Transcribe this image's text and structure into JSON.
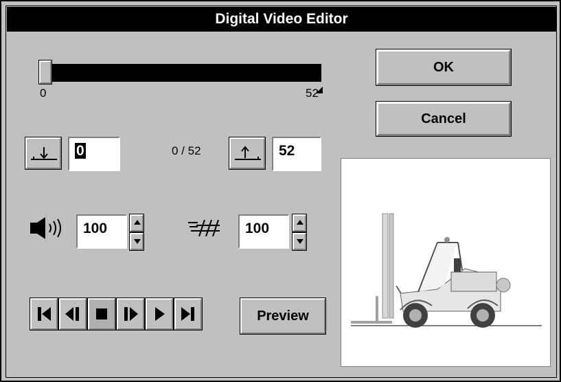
{
  "window": {
    "title": "Digital Video Editor"
  },
  "slider": {
    "min_label": "0",
    "max_label": "52",
    "position": 0,
    "max": 52
  },
  "buttons": {
    "ok": "OK",
    "cancel": "Cancel",
    "preview": "Preview"
  },
  "marks": {
    "in_value": "0",
    "out_value": "52",
    "frame_counter": "0 / 52"
  },
  "audio": {
    "volume": "100",
    "icon": "speaker-icon"
  },
  "video": {
    "quality": "100",
    "icon": "video-quality-icon"
  },
  "transport": [
    "skip-to-start-icon",
    "step-back-icon",
    "stop-icon",
    "step-forward-icon",
    "play-icon",
    "skip-to-end-icon"
  ],
  "preview_image": "forklift"
}
